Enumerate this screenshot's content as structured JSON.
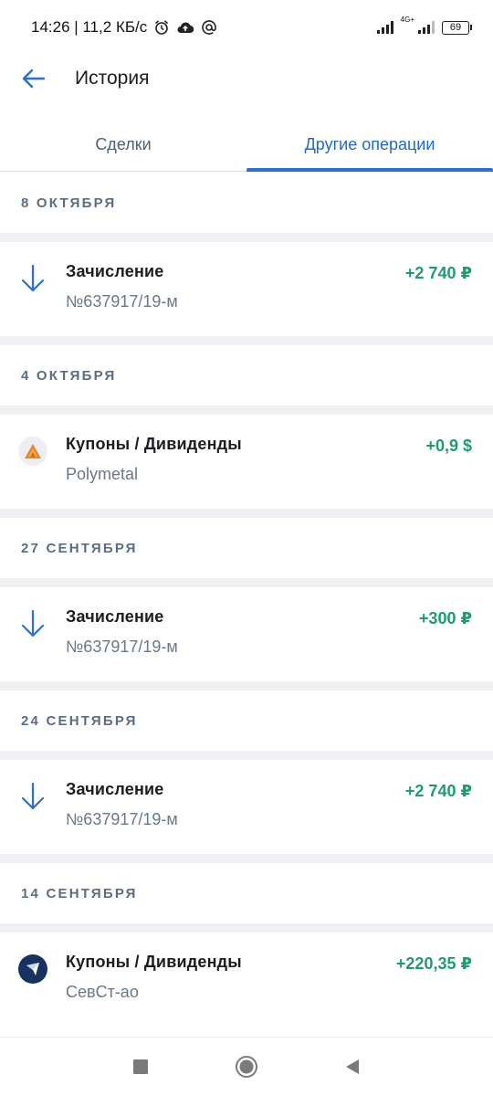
{
  "status_bar": {
    "time_speed": "14:26 | 11,2 КБ/с",
    "network": "4G+",
    "battery": "69"
  },
  "header": {
    "title": "История"
  },
  "tabs": [
    {
      "label": "Сделки",
      "active": false
    },
    {
      "label": "Другие операции",
      "active": true
    }
  ],
  "sections": [
    {
      "date": "8 ОКТЯБРЯ",
      "item": {
        "icon": "arrow-down-icon",
        "title": "Зачисление",
        "subtitle": "№637917/19-м",
        "amount": "+2 740 ₽"
      }
    },
    {
      "date": "4 ОКТЯБРЯ",
      "item": {
        "icon": "polymetal-logo-icon",
        "title": "Купоны / Дивиденды",
        "subtitle": "Polymetal",
        "amount": "+0,9 $"
      }
    },
    {
      "date": "27 СЕНТЯБРЯ",
      "item": {
        "icon": "arrow-down-icon",
        "title": "Зачисление",
        "subtitle": "№637917/19-м",
        "amount": "+300 ₽"
      }
    },
    {
      "date": "24 СЕНТЯБРЯ",
      "item": {
        "icon": "arrow-down-icon",
        "title": "Зачисление",
        "subtitle": "№637917/19-м",
        "amount": "+2 740 ₽"
      }
    },
    {
      "date": "14 СЕНТЯБРЯ",
      "item": {
        "icon": "severstal-logo-icon",
        "title": "Купоны / Дивиденды",
        "subtitle": "СевСт-ао",
        "amount": "+220,35 ₽"
      }
    }
  ],
  "colors": {
    "accent": "#1f6ad1",
    "income": "#1e9c6c",
    "muted": "#5b6d80"
  }
}
